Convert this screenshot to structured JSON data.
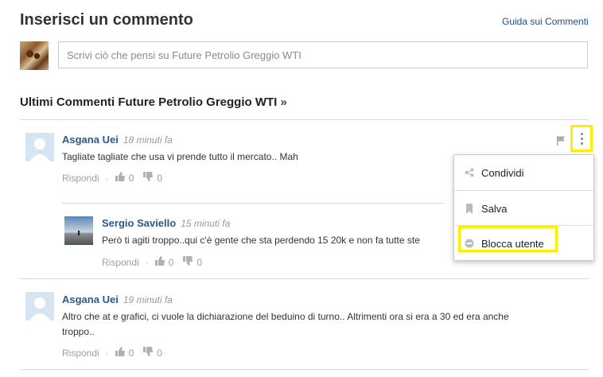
{
  "header": {
    "title": "Inserisci un commento",
    "guide_link": "Guida sui Commenti"
  },
  "comment_box": {
    "placeholder": "Scrivi ciò che pensi su Future Petrolio Greggio WTI"
  },
  "section": {
    "title": "Ultimi Commenti Future Petrolio Greggio WTI",
    "arrow": "»"
  },
  "comments": [
    {
      "author": "Asgana Uei",
      "time": "18 minuti fa",
      "text": "Tagliate tagliate che usa vi prende tutto il mercato.. Mah",
      "reply": "Rispondi",
      "likes": "0",
      "dislikes": "0"
    },
    {
      "author": "Sergio Saviello",
      "time": "15 minuti fa",
      "text": "Però ti agiti troppo..qui c'è gente che sta perdendo 15 20k e non fa tutte ste",
      "reply": "Rispondi",
      "likes": "0",
      "dislikes": "0"
    },
    {
      "author": "Asgana Uei",
      "time": "19 minuti fa",
      "text_line1": "Altro che at e grafici, ci vuole la dichiarazione del beduino di turno.. Altrimenti ora si era a 30 ed era anche",
      "text_line2": "troppo..",
      "reply": "Rispondi",
      "likes": "0",
      "dislikes": "0"
    }
  ],
  "context_menu": {
    "items": [
      {
        "label": "Condividi",
        "icon": "share-icon"
      },
      {
        "label": "Salva",
        "icon": "bookmark-icon"
      },
      {
        "label": "Blocca utente",
        "icon": "block-icon"
      }
    ]
  },
  "colors": {
    "link": "#2a5a8a",
    "highlight": "#ffee00"
  }
}
